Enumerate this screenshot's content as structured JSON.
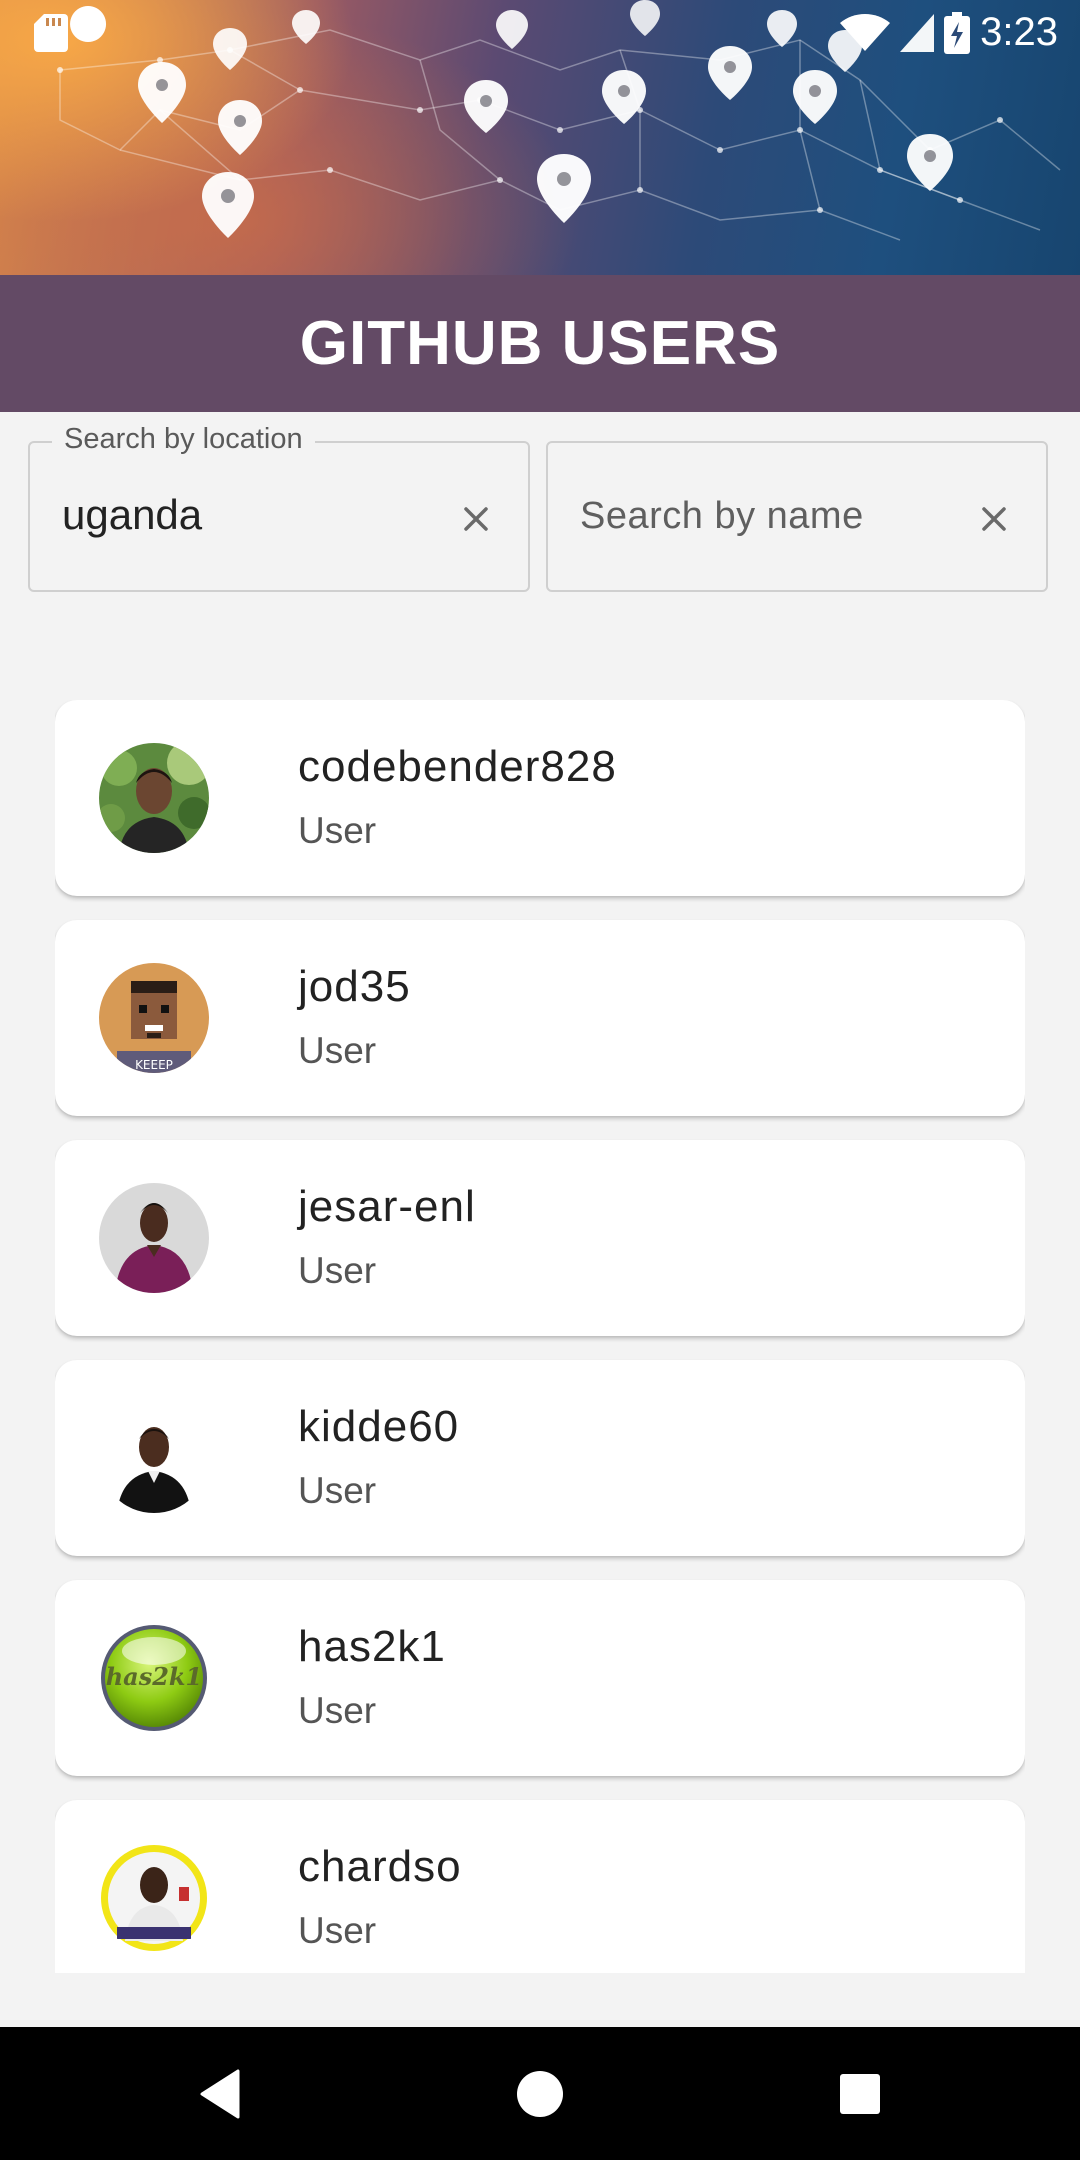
{
  "status_bar": {
    "time": "3:23"
  },
  "header": {
    "title": "GITHUB USERS"
  },
  "search": {
    "location": {
      "label": "Search by location",
      "value": "uganda"
    },
    "name": {
      "placeholder": "Search by name",
      "value": ""
    }
  },
  "users": [
    {
      "login": "codebender828",
      "type": "User",
      "avatar": "photo-man-green-background"
    },
    {
      "login": "jod35",
      "type": "User",
      "avatar": "pixel-art-face"
    },
    {
      "login": "jesar-enl",
      "type": "User",
      "avatar": "photo-man-purple-shirt"
    },
    {
      "login": "kidde60",
      "type": "User",
      "avatar": "photo-man-black-suit"
    },
    {
      "login": "has2k1",
      "type": "User",
      "avatar": "green-button-logo"
    },
    {
      "login": "chardso",
      "type": "User",
      "avatar": "photo-man-yellow-ring"
    }
  ],
  "has2k1_logo_text": "has2k1",
  "nav": {
    "back": "back-icon",
    "home": "home-icon",
    "recents": "recents-icon"
  },
  "colors": {
    "title_bar": "#634a65",
    "background": "#f3f3f3",
    "nav_bar": "#000000"
  }
}
